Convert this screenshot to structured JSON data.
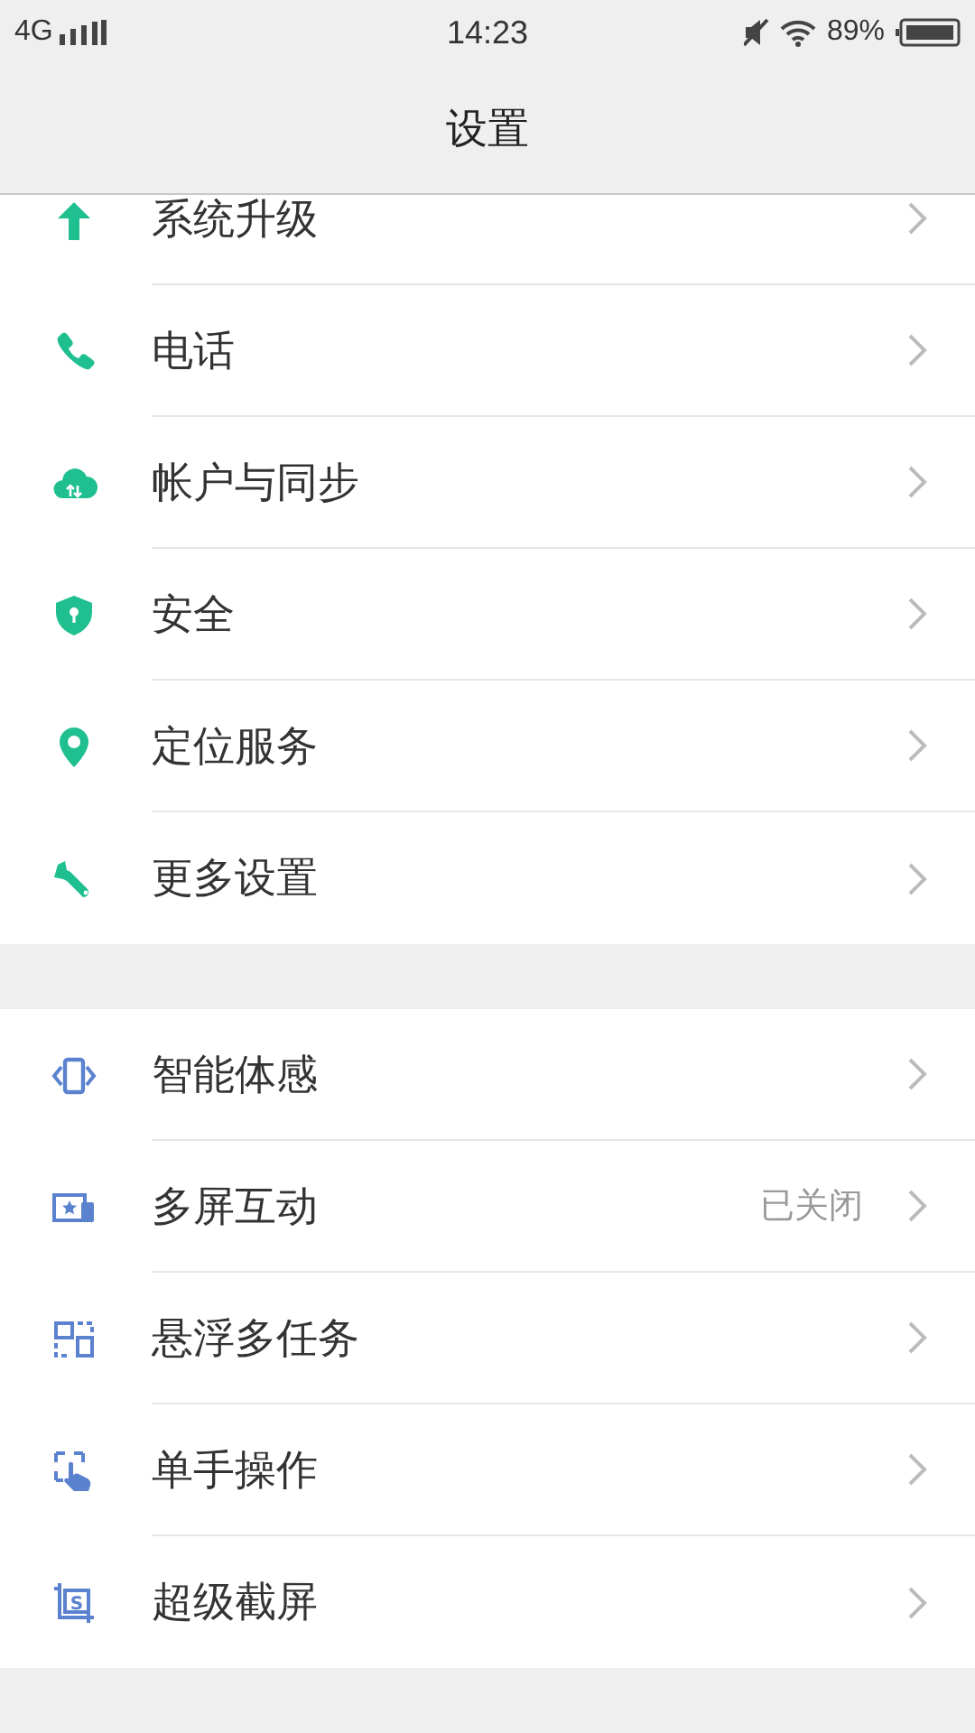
{
  "status_bar": {
    "network": "4G",
    "time": "14:23",
    "battery": "89%"
  },
  "header": {
    "title": "设置"
  },
  "groups": [
    {
      "items": [
        {
          "label": "系统升级"
        },
        {
          "label": "电话"
        },
        {
          "label": "帐户与同步"
        },
        {
          "label": "安全"
        },
        {
          "label": "定位服务"
        },
        {
          "label": "更多设置"
        }
      ]
    },
    {
      "items": [
        {
          "label": "智能体感"
        },
        {
          "label": "多屏互动",
          "value": "已关闭"
        },
        {
          "label": "悬浮多任务"
        },
        {
          "label": "单手操作"
        },
        {
          "label": "超级截屏",
          "icon_label": "S"
        }
      ]
    }
  ]
}
